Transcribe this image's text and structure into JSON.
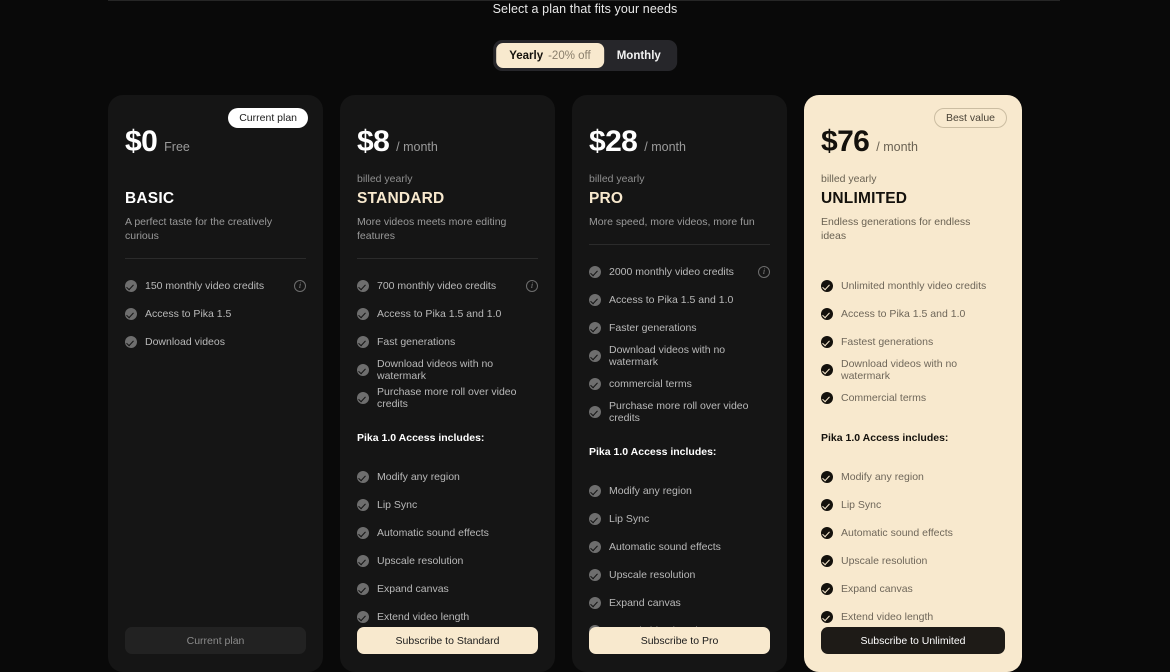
{
  "header": {
    "title": "Select a plan that fits your needs"
  },
  "billing_toggle": {
    "yearly_label": "Yearly",
    "yearly_discount": "-20% off",
    "monthly_label": "Monthly",
    "selected": "Yearly",
    "active_bg": "#f8e9ce"
  },
  "colors": {
    "page_bg": "#090909",
    "card_bg": "#151515",
    "accent_cream": "#f8e9ce",
    "muted_text": "#9a9a9a"
  },
  "section_heading": "Pika 1.0 Access includes:",
  "plans": [
    {
      "badge": "Current plan",
      "price": "$0",
      "price_suffix": "Free",
      "billed": "",
      "name": "BASIC",
      "tagline": "A perfect taste for the creatively curious",
      "features": [
        {
          "label": "150 monthly video credits",
          "info": true
        },
        {
          "label": "Access to Pika 1.5",
          "info": false
        },
        {
          "label": "Download videos",
          "info": false
        }
      ],
      "pika_features": [],
      "cta_label": "Current plan"
    },
    {
      "badge": "",
      "price": "$8",
      "price_suffix": "/ month",
      "billed": "billed yearly",
      "name": "STANDARD",
      "tagline": "More videos meets more editing features",
      "features": [
        {
          "label": "700 monthly video credits",
          "info": true
        },
        {
          "label": "Access to Pika 1.5 and 1.0",
          "info": false
        },
        {
          "label": "Fast generations",
          "info": false
        },
        {
          "label": "Download videos with no watermark",
          "info": false
        },
        {
          "label": "Purchase more roll over video credits",
          "info": false
        }
      ],
      "pika_features": [
        "Modify any region",
        "Lip Sync",
        "Automatic sound effects",
        "Upscale resolution",
        "Expand canvas",
        "Extend video length"
      ],
      "cta_label": "Subscribe to Standard"
    },
    {
      "badge": "",
      "price": "$28",
      "price_suffix": "/ month",
      "billed": "billed yearly",
      "name": "PRO",
      "tagline": "More speed, more videos, more fun",
      "features": [
        {
          "label": "2000 monthly video credits",
          "info": true
        },
        {
          "label": "Access to Pika 1.5 and 1.0",
          "info": false
        },
        {
          "label": "Faster generations",
          "info": false
        },
        {
          "label": "Download videos with no watermark",
          "info": false
        },
        {
          "label": "commercial terms",
          "info": false
        },
        {
          "label": "Purchase more roll over video credits",
          "info": false
        }
      ],
      "pika_features": [
        "Modify any region",
        "Lip Sync",
        "Automatic sound effects",
        "Upscale resolution",
        "Expand canvas",
        "Extend video length"
      ],
      "cta_label": "Subscribe to Pro"
    },
    {
      "badge": "Best value",
      "price": "$76",
      "price_suffix": "/ month",
      "billed": "billed yearly",
      "name": "UNLIMITED",
      "tagline": "Endless generations for endless ideas",
      "features": [
        {
          "label": "Unlimited monthly video credits",
          "info": false
        },
        {
          "label": "Access to Pika 1.5 and 1.0",
          "info": false
        },
        {
          "label": "Fastest generations",
          "info": false
        },
        {
          "label": "Download videos with no watermark",
          "info": false
        },
        {
          "label": "Commercial terms",
          "info": false
        }
      ],
      "pika_features": [
        "Modify any region",
        "Lip Sync",
        "Automatic sound effects",
        "Upscale resolution",
        "Expand canvas",
        "Extend video length"
      ],
      "cta_label": "Subscribe to Unlimited"
    }
  ]
}
